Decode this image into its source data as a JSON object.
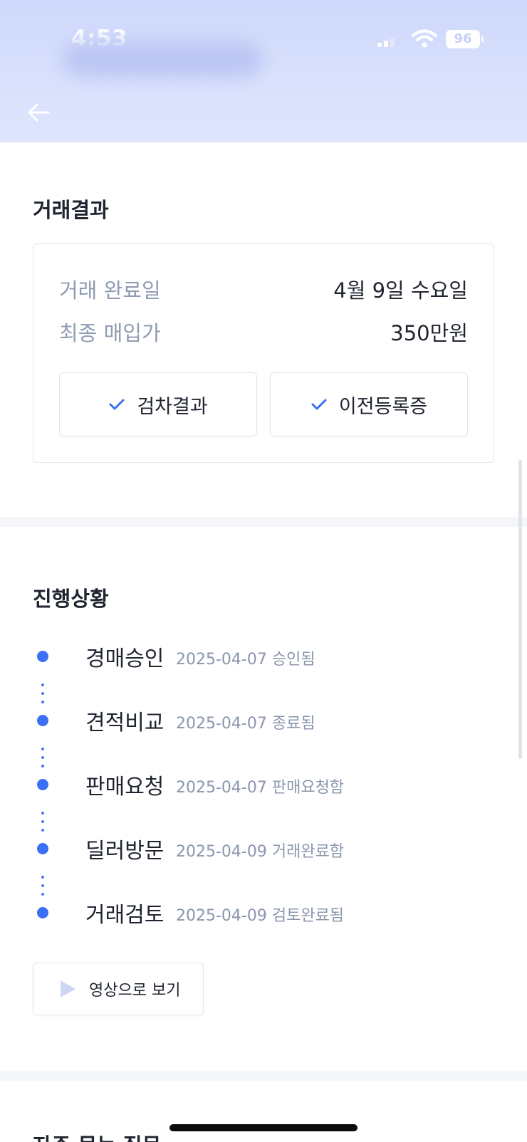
{
  "status_bar": {
    "time": "4:53",
    "battery": "96"
  },
  "header": {
    "back_icon": "arrow-left-icon"
  },
  "result": {
    "title": "거래결과",
    "rows": [
      {
        "label": "거래 완료일",
        "value": "4월 9일 수요일"
      },
      {
        "label": "최종 매입가",
        "value": "350만원"
      }
    ],
    "buttons": [
      {
        "label": "검차결과",
        "icon": "check-icon"
      },
      {
        "label": "이전등록증",
        "icon": "check-icon"
      }
    ]
  },
  "progress": {
    "title": "진행상황",
    "steps": [
      {
        "name": "경매승인",
        "meta": "2025-04-07 승인됨"
      },
      {
        "name": "견적비교",
        "meta": "2025-04-07 종료됨"
      },
      {
        "name": "판매요청",
        "meta": "2025-04-07 판매요청함"
      },
      {
        "name": "딜러방문",
        "meta": "2025-04-09 거래완료함"
      },
      {
        "name": "거래검토",
        "meta": "2025-04-09 검토완료됨"
      }
    ],
    "video_button": {
      "label": "영상으로 보기",
      "icon": "play-icon"
    }
  },
  "next_section": {
    "title": "자주 묻는 질문"
  },
  "colors": {
    "accent": "#3b6ff5",
    "header_bg": "#d6defc",
    "muted_text": "#8f9bb3",
    "play_icon": "#cdd6f6"
  }
}
